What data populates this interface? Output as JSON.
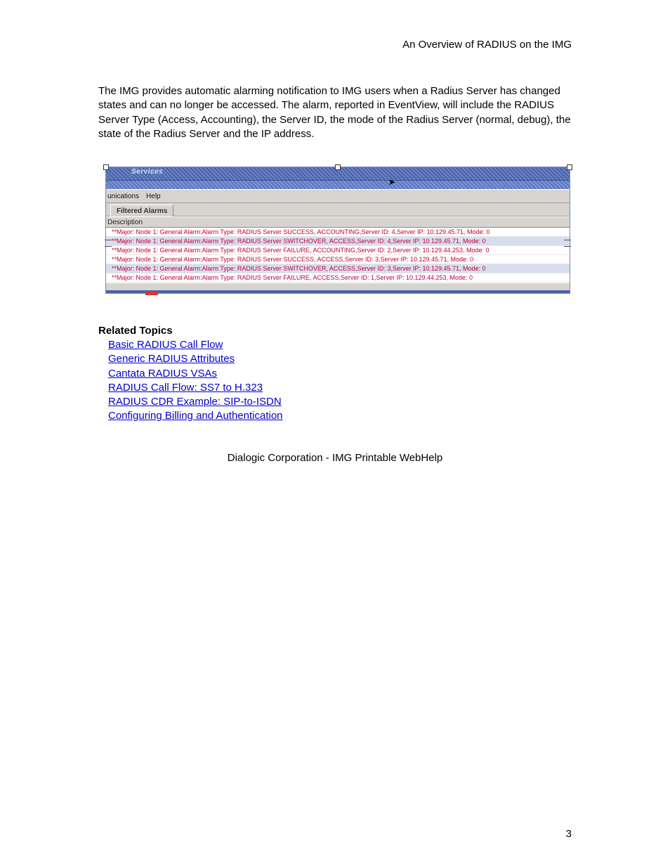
{
  "header": {
    "right": "An Overview of RADIUS on the IMG"
  },
  "body": {
    "paragraph": "The IMG provides automatic alarming notification to IMG users when a Radius Server has changed states and can no longer be accessed. The alarm, reported in EventView, will include the RADIUS Server Type (Access, Accounting), the Server ID, the mode of the Radius Server (normal, debug), the state of the Radius Server and the IP address."
  },
  "eventview": {
    "title_fragment": "Services",
    "menubar": {
      "left": "unications",
      "help": "Help"
    },
    "tab": "Filtered Alarms",
    "column_header": "Description",
    "rows": [
      "**Major: Node 1: General Alarm:Alarm Type: RADIUS Server SUCCESS,  ACCOUNTING,Server ID: 4,Server IP: 10.129.45.71, Mode: 0",
      "**Major: Node 1: General Alarm:Alarm Type: RADIUS Server SWITCHOVER,  ACCESS,Server ID: 4,Server IP: 10.129.45.71, Mode: 0",
      "**Major: Node 1: General Alarm:Alarm Type: RADIUS Server FAILURE,  ACCOUNTING,Server ID: 2,Server IP: 10.129.44.253, Mode: 0",
      "**Major: Node 1: General Alarm:Alarm Type: RADIUS Server SUCCESS,  ACCESS,Server ID: 3,Server IP: 10.129.45.71, Mode: 0",
      "**Major: Node 1: General Alarm:Alarm Type: RADIUS Server SWITCHOVER,  ACCESS,Server ID: 3,Server IP: 10.129.45.71, Mode: 0",
      "**Major: Node 1: General Alarm:Alarm Type: RADIUS Server FAILURE,  ACCESS,Server ID: 1,Server IP: 10.129.44.253, Mode: 0"
    ],
    "selected_indices": [
      1,
      4
    ]
  },
  "related": {
    "heading": "Related Topics",
    "links": [
      "Basic RADIUS Call Flow",
      "Generic RADIUS Attributes",
      "Cantata RADIUS VSAs",
      "RADIUS Call Flow: SS7 to H.323",
      "RADIUS CDR Example: SIP-to-ISDN",
      "Configuring Billing and Authentication"
    ]
  },
  "footer": {
    "center": "Dialogic Corporation - IMG Printable WebHelp",
    "page_number": "3"
  }
}
